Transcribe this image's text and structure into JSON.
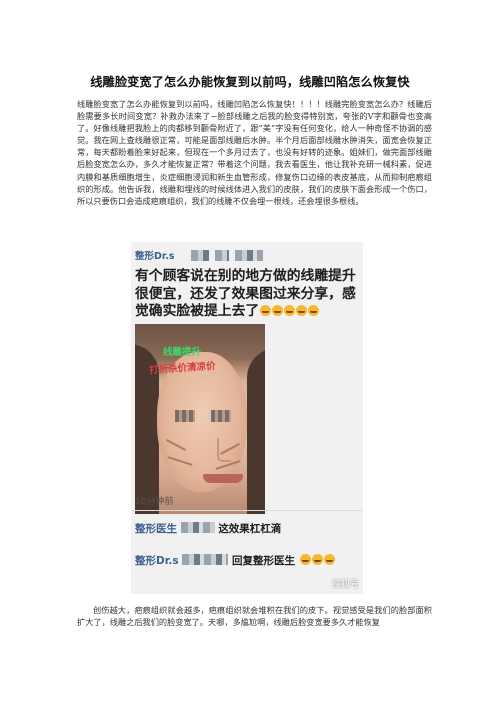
{
  "title": "线雕脸变宽了怎么办能恢复到以前吗，线雕凹陷怎么恢复快",
  "paragraph_1": "线雕脸变宽了怎么办能恢复到以前吗，线雕凹陷怎么恢复快！！！！线雕完脸变宽怎么办？线雕后脸需要多长时间变宽？补救办法来了~脸部线雕之后我的脸变得特别宽，夸张的V字和颧骨也变高了。好像线雕把我脸上的肉都移到颧骨附近了，跟“美”字没有任何变化，给人一种奇怪不协调的感觉。我在网上查线雕很正常，可能是面部线雕后水肿。半个月后面部线雕水肿消失，面宽会恢复正常，每天都盼着脸来好起来，但现在一个多月过去了，也没有好转的迹象。姐妹们，做完面部线雕后脸变宽怎么办，多久才能恢复正常？带着这个问题，我去看医生，他让我补充研一械科素，促进内膜和基质细胞增生，炎症细胞浸润和新生血管形成，修复伤口边缘的表皮基底，从而抑制疤痕组织的形成。他告诉我，线雕和埋线的时候线体进入我们的皮肤，我们的皮肤下面会形成一个伤口，所以只要伤口会造成疤痕组织，我们的线雕不仅会埋一根线，还会埋很多根线。",
  "paragraph_2": "创伤越大，疤痕组织就会越多，疤痕组织就会堆积在我们的皮下。视觉感受是我们的脸部面积扩大了，线雕之后我们的脸变宽了。天哪，多尴尬啊，线雕后脸变宽要多久才能恢复",
  "screenshot": {
    "sender_prefix": "整形Dr.s",
    "message": "有个顾客说在别的地方做的线雕提升很便宜，还发了效果图过来分享，感觉确实脸被提上去了",
    "photo_caption_1": "线雕提升",
    "photo_caption_2": "打折杀价清凉价",
    "time": "10分钟前",
    "reply_1_who": "整形医生",
    "reply_1_text": "这效果杠杠滴",
    "reply_2_who": "整形Dr.s",
    "reply_2_text": "回复整形医生",
    "watermark": "搜狐号"
  },
  "colors": {
    "sender": "#3e5f90",
    "caption_green": "#3bd96a",
    "caption_red": "#d93a3a"
  }
}
